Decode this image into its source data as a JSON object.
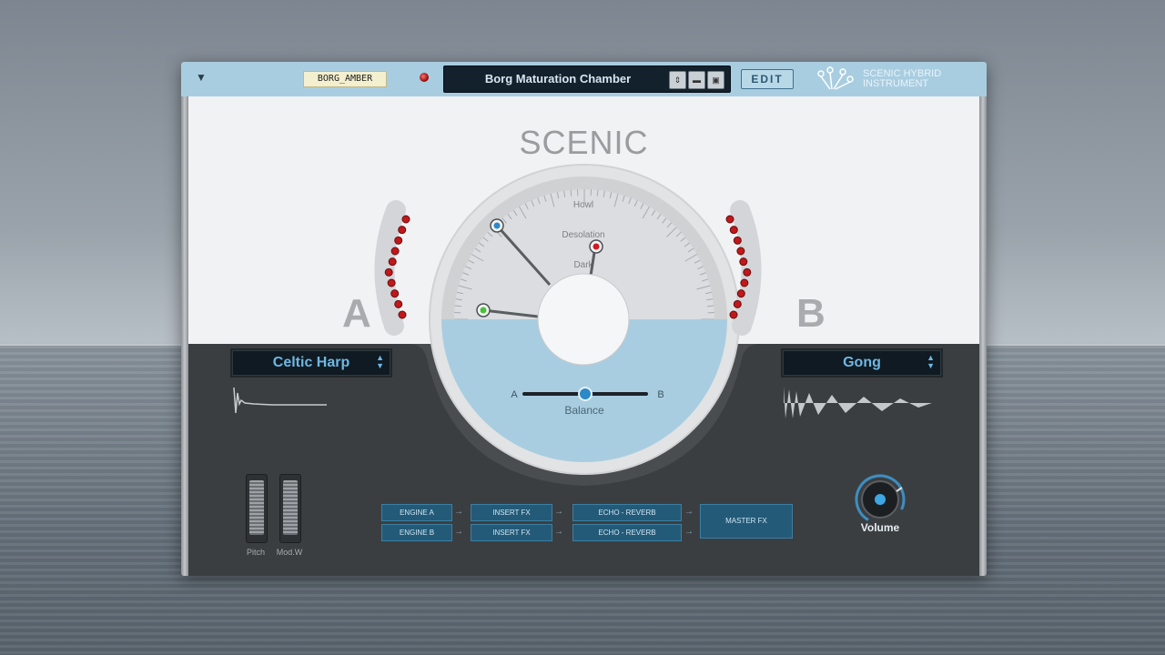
{
  "header": {
    "tag_label": "BORG_AMBER",
    "preset_name": "Borg Maturation Chamber",
    "edit_label": "EDIT",
    "logo_line1": "SCENIC HYBRID",
    "logo_line2": "INSTRUMENT"
  },
  "brand": {
    "title": "SCENIC"
  },
  "dial": {
    "labels": [
      "Howl",
      "Desolation",
      "Dark"
    ],
    "balance_label": "Balance",
    "balance_a": "A",
    "balance_b": "B",
    "balance_value": 0.5
  },
  "layers": {
    "a": {
      "letter": "A",
      "instrument": "Celtic Harp"
    },
    "b": {
      "letter": "B",
      "instrument": "Gong"
    }
  },
  "controls": {
    "pitch_label": "Pitch",
    "modw_label": "Mod.W",
    "volume_label": "Volume"
  },
  "routing": {
    "engine_a": "ENGINE A",
    "engine_b": "ENGINE B",
    "insert_a": "INSERT FX",
    "insert_b": "INSERT FX",
    "echo_a": "ECHO - REVERB",
    "echo_b": "ECHO - REVERB",
    "master": "MASTER FX"
  },
  "colors": {
    "accent": "#6fb7e3",
    "header_bar": "#a9cde0",
    "led_red": "#c0181b",
    "dial_blue": "#a9cde0"
  }
}
